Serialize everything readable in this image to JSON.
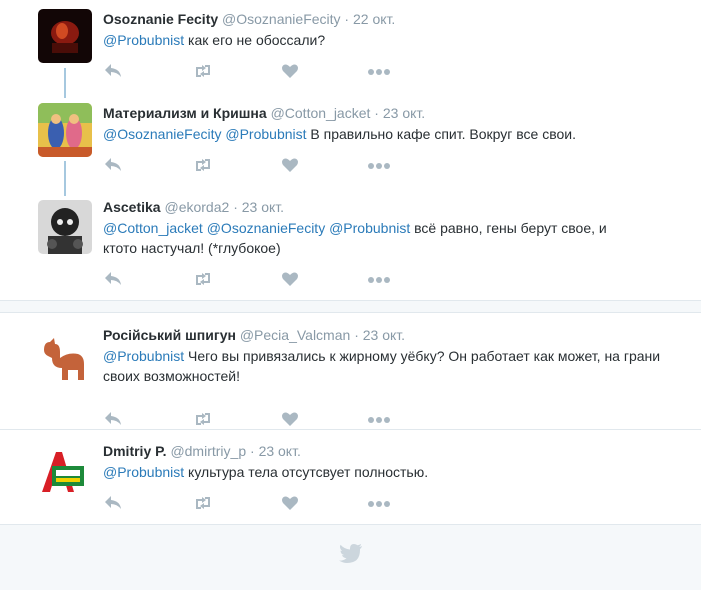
{
  "tweets": [
    {
      "name": "Osoznanie Fecity",
      "handle": "@OsoznanieFecity",
      "sep": "·",
      "time": "22 окт.",
      "mention": "@Probubnist",
      "text": " как его не обоссали?"
    },
    {
      "name": "Материализм и Кришна",
      "handle": "@Cotton_jacket",
      "sep": "·",
      "time": "23 окт.",
      "mention1": "@OsoznanieFecity",
      "mention2": "@Probubnist",
      "text": " В правильно кафе спит. Вокруг все свои."
    },
    {
      "name": "Ascetika",
      "handle": "@ekorda2",
      "sep": "·",
      "time": "23 окт.",
      "mention1": "@Cotton_jacket",
      "mention2": "@OsoznanieFecity",
      "mention3": "@Probubnist",
      "text": " всё равно, гены берут свое, и ктото настучал! (*глубокое)"
    },
    {
      "name": "Російський шпигун",
      "handle": "@Pecia_Valcman",
      "sep": "·",
      "time": "23 окт.",
      "mention": "@Probubnist",
      "text": " Чего вы привязались к жирному уёбку? Он работает как может, на грани своих возможностей!"
    },
    {
      "name": "Dmitriy P.",
      "handle": "@dmirtriy_p",
      "sep": "·",
      "time": "23 окт.",
      "mention": "@Probubnist",
      "text": " культура тела отсутсвует полностью."
    }
  ],
  "icons": {
    "reply": "reply-icon",
    "retweet": "retweet-icon",
    "like": "heart-icon",
    "more": "more-icon",
    "footer": "twitter-bird-icon"
  },
  "colors": {
    "mention": "#2b7bb9",
    "muted": "#8899a6",
    "action": "#aab8c2",
    "thread": "#a6c8df"
  }
}
